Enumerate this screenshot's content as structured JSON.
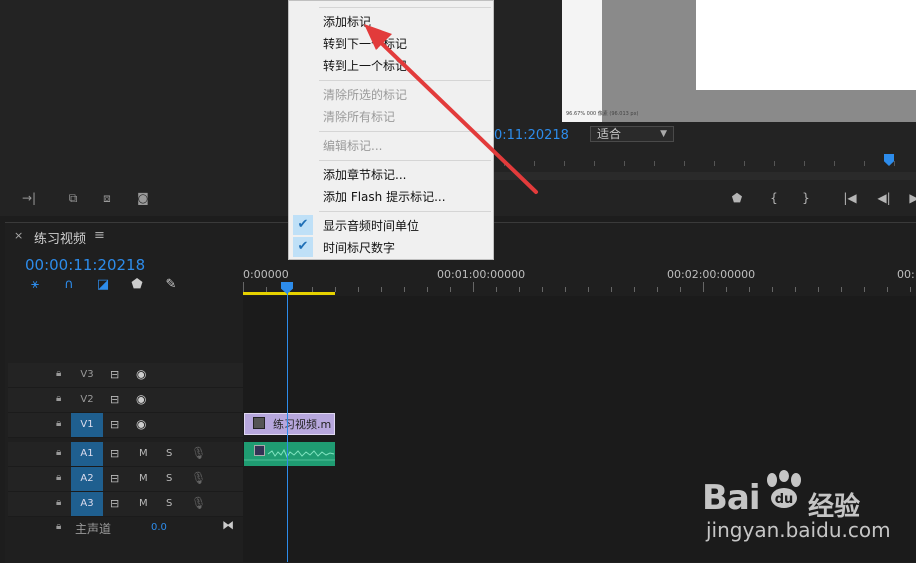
{
  "context_menu": {
    "items": [
      {
        "label": "添加标记",
        "enabled": true
      },
      {
        "label": "转到下一个标记",
        "enabled": true
      },
      {
        "label": "转到上一个标记",
        "enabled": true
      },
      {
        "label": "清除所选的标记",
        "enabled": false
      },
      {
        "label": "清除所有标记",
        "enabled": false
      },
      {
        "label": "编辑标记...",
        "enabled": false
      },
      {
        "label": "添加章节标记...",
        "enabled": true
      },
      {
        "label": "添加 Flash 提示标记...",
        "enabled": true
      },
      {
        "label": "显示音频时间单位",
        "enabled": true,
        "checked": true
      },
      {
        "label": "时间标尺数字",
        "enabled": true,
        "checked": true
      }
    ]
  },
  "program_monitor": {
    "timecode": "0:11:20218",
    "fit_label": "适合",
    "info_text": "96.67% 000 像素 (96.013 px)"
  },
  "timeline": {
    "close_glyph": "×",
    "title": "练习视频",
    "menu_glyph": "≡",
    "timecode": "00:00:11:20218",
    "ruler_labels": [
      "0:00000",
      "00:01:00:00000",
      "00:02:00:00000",
      "00:"
    ],
    "tracks": [
      {
        "name": "V3",
        "type": "video",
        "active": false
      },
      {
        "name": "V2",
        "type": "video",
        "active": false
      },
      {
        "name": "V1",
        "type": "video",
        "active": true
      },
      {
        "name": "A1",
        "type": "audio",
        "active": true,
        "m": "M",
        "s": "S"
      },
      {
        "name": "A2",
        "type": "audio",
        "active": true,
        "m": "M",
        "s": "S"
      },
      {
        "name": "A3",
        "type": "audio",
        "active": true,
        "m": "M",
        "s": "S"
      }
    ],
    "master": {
      "label": "主声道",
      "value": "0.0"
    },
    "clip_video_label": "练习视频.m"
  },
  "watermark": {
    "logo": "Bai",
    "logo_suffix": "du",
    "brand": "经验",
    "url": "jingyan.baidu.com"
  },
  "colors": {
    "accent_blue": "#2d8ceb",
    "video_clip": "#b7a7dd",
    "audio_clip": "#1f9c72",
    "work_area": "#e6d200",
    "annotation_arrow": "#e23b3b"
  }
}
